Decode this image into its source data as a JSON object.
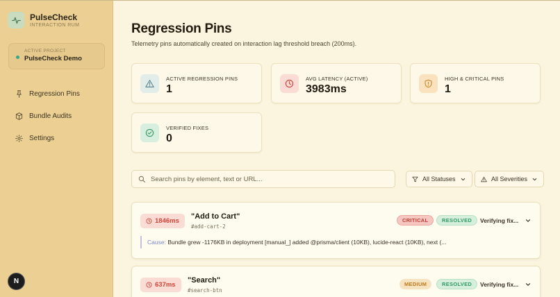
{
  "brand": {
    "name": "PulseCheck",
    "subtitle": "INTERACTION RUM"
  },
  "project": {
    "label": "ACTIVE PROJECT",
    "name": "PulseCheck Demo"
  },
  "nav": [
    {
      "label": "Regression Pins",
      "icon": "pin-icon"
    },
    {
      "label": "Bundle Audits",
      "icon": "package-icon"
    },
    {
      "label": "Settings",
      "icon": "gear-icon"
    }
  ],
  "user": {
    "initial": "N"
  },
  "page": {
    "title": "Regression Pins",
    "subtitle": "Telemetry pins automatically created on interaction lag threshold breach (200ms)."
  },
  "stats": [
    {
      "label": "ACTIVE REGRESSION PINS",
      "value": "1",
      "icon": "warning-icon",
      "color": "#6a8a92"
    },
    {
      "label": "AVG LATENCY (ACTIVE)",
      "value": "3983ms",
      "icon": "clock-icon",
      "color": "#d0453a"
    },
    {
      "label": "HIGH & CRITICAL PINS",
      "value": "1",
      "icon": "shield-icon",
      "color": "#c9862a"
    },
    {
      "label": "VERIFIED FIXES",
      "value": "0",
      "icon": "check-circle-icon",
      "color": "#3a9a68"
    }
  ],
  "search": {
    "placeholder": "Search pins by element, text or URL..."
  },
  "filters": {
    "status": "All Statuses",
    "severity": "All Severities"
  },
  "pins": [
    {
      "latency": "1846ms",
      "title": "\"Add to Cart\"",
      "selector": "#add-cart-2",
      "severity": "CRITICAL",
      "status": "RESOLVED",
      "state": "Verifying fix...",
      "cause_label": "Cause:",
      "cause": "Bundle grew -1176KB in deployment [manual_] added @prisma/client (10KB), lucide-react (10KB), next (..."
    },
    {
      "latency": "637ms",
      "title": "\"Search\"",
      "selector": "#search-btn",
      "severity": "MEDIUM",
      "status": "RESOLVED",
      "state": "Verifying fix..."
    }
  ]
}
